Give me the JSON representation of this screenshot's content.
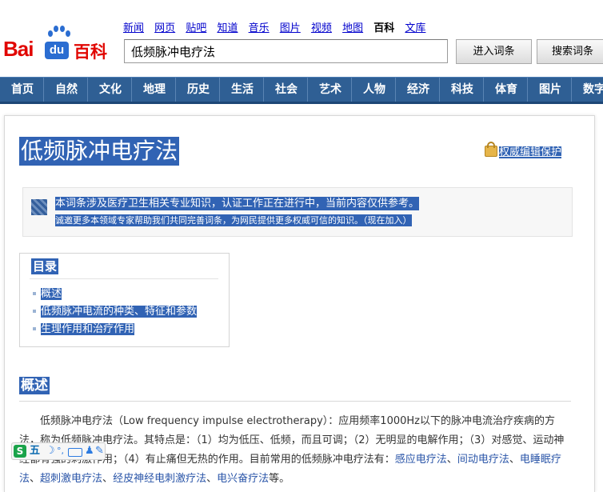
{
  "header": {
    "logo": {
      "bai": "Bai",
      "du": "du",
      "baike": "百科"
    },
    "nav": [
      {
        "label": "新闻"
      },
      {
        "label": "网页"
      },
      {
        "label": "贴吧"
      },
      {
        "label": "知道"
      },
      {
        "label": "音乐"
      },
      {
        "label": "图片"
      },
      {
        "label": "视频"
      },
      {
        "label": "地图"
      },
      {
        "label": "百科"
      },
      {
        "label": "文库"
      }
    ],
    "search_value": "低频脉冲电疗法",
    "enter_button": "进入词条",
    "search_button": "搜索词条"
  },
  "categories": [
    "首页",
    "自然",
    "文化",
    "地理",
    "历史",
    "生活",
    "社会",
    "艺术",
    "人物",
    "经济",
    "科技",
    "体育",
    "图片",
    "数字博物馆"
  ],
  "article": {
    "title": "低频脉冲电疗法",
    "protect_label": "权威编辑保护",
    "notice": {
      "line1": "本词条涉及医疗卫生相关专业知识，认证工作正在进行中，当前内容仅供参考。",
      "line2": "诚邀更多本领域专家帮助我们共同完善词条，为网民提供更多权威可信的知识。（现在加入）"
    },
    "toc": {
      "title": "目录",
      "items": [
        "概述",
        "低频脉冲电流的种类、特征和参数",
        "生理作用和治疗作用"
      ]
    },
    "section": {
      "heading": "概述",
      "p1": "低频脉冲电疗法（Low frequency impulse electrotherapy）：应用频率1000Hz以下的脉冲电流治疗疾病的方法，称为低频脉冲电疗法。其特点是：（1）均为低压、低频，而且可调；（2）无明显的电解作用；（3）对感觉、运动神经都有强的刺激作用；（4）有止痛但无热的作用。目前常用的低频脉冲电疗法有：",
      "links": [
        "感应电疗法",
        "间动电疗法",
        "电睡眠疗法",
        "超刺激电疗法",
        "经皮神经电刺激疗法",
        "电兴奋疗法"
      ],
      "sep": "、",
      "end": "等。"
    }
  },
  "ime": {
    "s": "S",
    "wu": "五",
    "moon": "☽",
    "dot": "°,",
    "person": "♟",
    "wrench": "✎"
  },
  "colors": {
    "highlight": "#3163b4",
    "nav_bar": "#2f5f94",
    "link": "#00c",
    "logo_red": "#e10601",
    "logo_blue": "#2b6dd1"
  }
}
